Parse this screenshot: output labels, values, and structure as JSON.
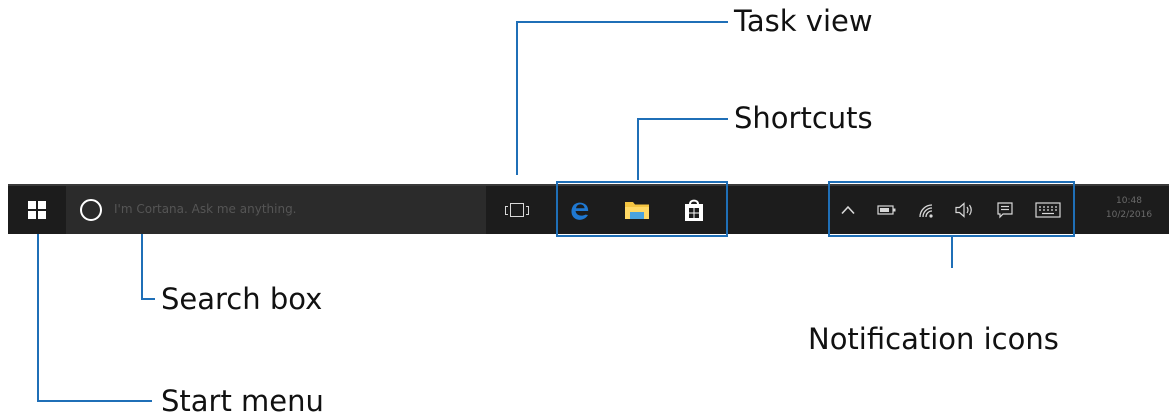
{
  "labels": {
    "task_view": "Task view",
    "shortcuts": "Shortcuts",
    "search_box": "Search box",
    "notification_icons": "Notification icons",
    "start_menu": "Start menu"
  },
  "taskbar": {
    "search_placeholder": "I'm Cortana. Ask me anything.",
    "clock_time": "10:48",
    "clock_date": "10/2/2016"
  },
  "icons": {
    "start": "windows-logo-icon",
    "cortana": "cortana-circle-icon",
    "task_view": "task-view-icon",
    "shortcuts": [
      "edge-browser-icon",
      "file-explorer-icon",
      "store-icon"
    ],
    "notifications": [
      "chevron-up-icon",
      "battery-icon",
      "wifi-icon",
      "volume-icon",
      "action-center-icon",
      "keyboard-icon"
    ]
  },
  "colors": {
    "callout": "#1f6fb7",
    "taskbar": "#1c1c1c",
    "search_box": "#2b2b2b",
    "edge": "#1f78d1",
    "explorer": "#f4c542",
    "tray_icons": "#d8d8d8"
  }
}
